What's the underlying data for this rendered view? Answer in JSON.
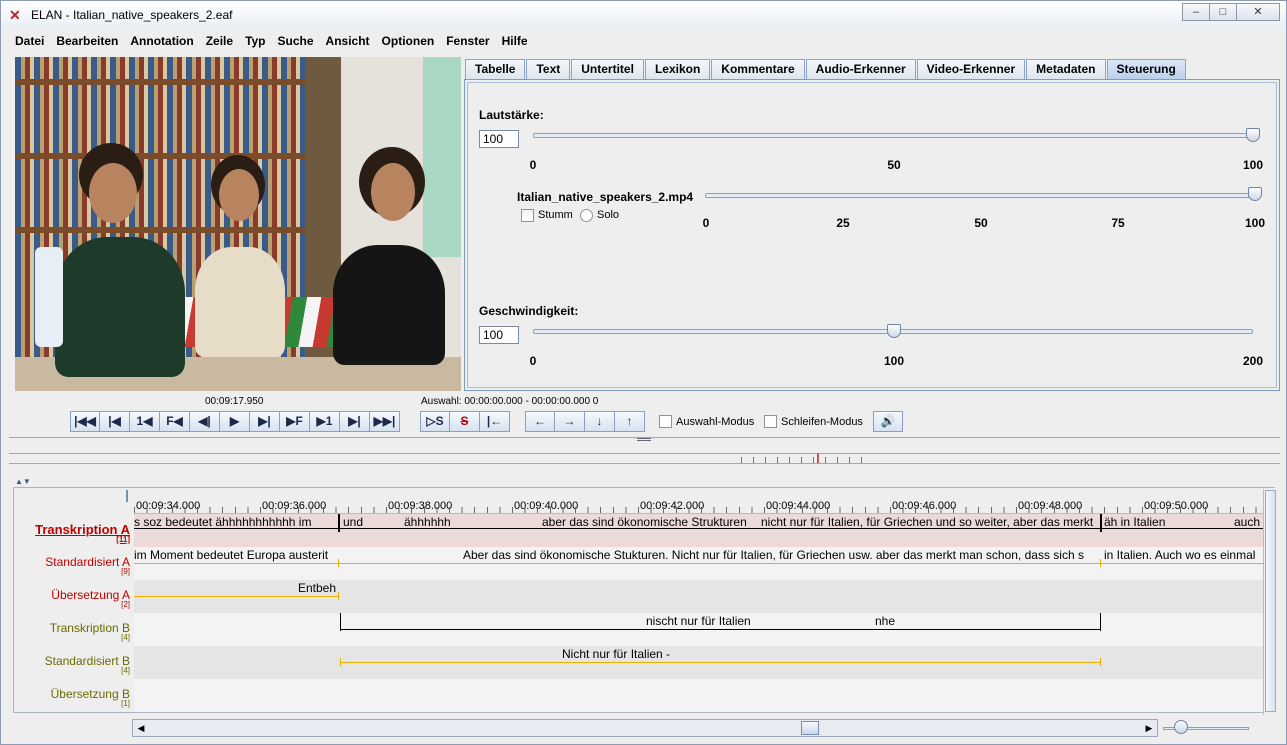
{
  "window": {
    "title": "ELAN - Italian_native_speakers_2.eaf",
    "controls": {
      "minimize": "–",
      "maximize": "□",
      "close": "✕"
    }
  },
  "menu": [
    {
      "label": "Datei"
    },
    {
      "label": "Bearbeiten"
    },
    {
      "label": "Annotation"
    },
    {
      "label": "Zeile"
    },
    {
      "label": "Typ"
    },
    {
      "label": "Suche"
    },
    {
      "label": "Ansicht"
    },
    {
      "label": "Optionen"
    },
    {
      "label": "Fenster"
    },
    {
      "label": "Hilfe"
    }
  ],
  "tabs": [
    "Tabelle",
    "Text",
    "Untertitel",
    "Lexikon",
    "Kommentare",
    "Audio-Erkenner",
    "Video-Erkenner",
    "Metadaten",
    "Steuerung"
  ],
  "active_tab": "Steuerung",
  "controls_panel": {
    "volume": {
      "label": "Lautstärke:",
      "value": "100",
      "ticks": [
        "0",
        "50",
        "100"
      ],
      "level": 1.0
    },
    "media": {
      "label": "Italian_native_speakers_2.mp4",
      "mute_label": "Stumm",
      "solo_label": "Solo",
      "ticks": [
        "0",
        "25",
        "50",
        "75",
        "100"
      ],
      "level": 1.0
    },
    "speed": {
      "label": "Geschwindigkeit:",
      "value": "100",
      "ticks": [
        "0",
        "100",
        "200"
      ],
      "level": 0.5
    }
  },
  "player": {
    "current_time": "00:09:17.950",
    "selection": "Auswahl: 00:00:00.000 - 00:00:00.000  0",
    "buttons": [
      "|◀◀",
      "|◀",
      "1◀",
      "F◀",
      "◀|",
      "▶",
      "▶|",
      "▶F",
      "▶1",
      "▶|",
      "▶▶|"
    ],
    "selection_buttons": [
      "▷S",
      "S",
      "|←"
    ],
    "nav_buttons": [
      "←",
      "→",
      "↓",
      "↑"
    ],
    "selection_mode_label": "Auswahl-Modus",
    "loop_mode_label": "Schleifen-Modus",
    "speaker_icon": "🔊"
  },
  "timeline": {
    "ruler_labels": [
      "00:09:34.000",
      "00:09:36.000",
      "00:09:38.000",
      "00:09:40.000",
      "00:09:42.000",
      "00:09:44.000",
      "00:09:46.000",
      "00:09:48.000",
      "00:09:50.000"
    ],
    "tiers": [
      {
        "name": "Transkription A",
        "count": "[11]",
        "color": "#c00000",
        "active": true,
        "annotations": [
          "s soz bedeutet ähhhhhhhhhhh im",
          "und",
          "ähhhhhh",
          "aber das sind ökonomische Strukturen",
          "nicht nur für Italien, für Griechen und so weiter, aber das merkt",
          "äh in Italien",
          "auch"
        ]
      },
      {
        "name": "Standardisiert A",
        "count": "[9]",
        "color": "#c00000",
        "annotations": [
          "im Moment bedeutet Europa austerit",
          "Aber das sind ökonomische Stukturen. Nicht nur für Italien, für Griechen usw. aber das merkt man schon, dass sich s",
          "in Italien. Auch wo es einmal"
        ]
      },
      {
        "name": "Übersetzung A",
        "count": "[2]",
        "color": "#c00000",
        "annotations": [
          "Entbeh"
        ]
      },
      {
        "name": "Transkription B",
        "count": "[4]",
        "color": "#6b6b00",
        "annotations": [
          "nischt nur für Italien",
          "nhe"
        ]
      },
      {
        "name": "Standardisiert B",
        "count": "[4]",
        "color": "#6b6b00",
        "annotations": [
          "Nicht nur für Italien -"
        ]
      },
      {
        "name": "Übersetzung B",
        "count": "[1]",
        "color": "#6b6b00",
        "annotations": []
      }
    ]
  }
}
